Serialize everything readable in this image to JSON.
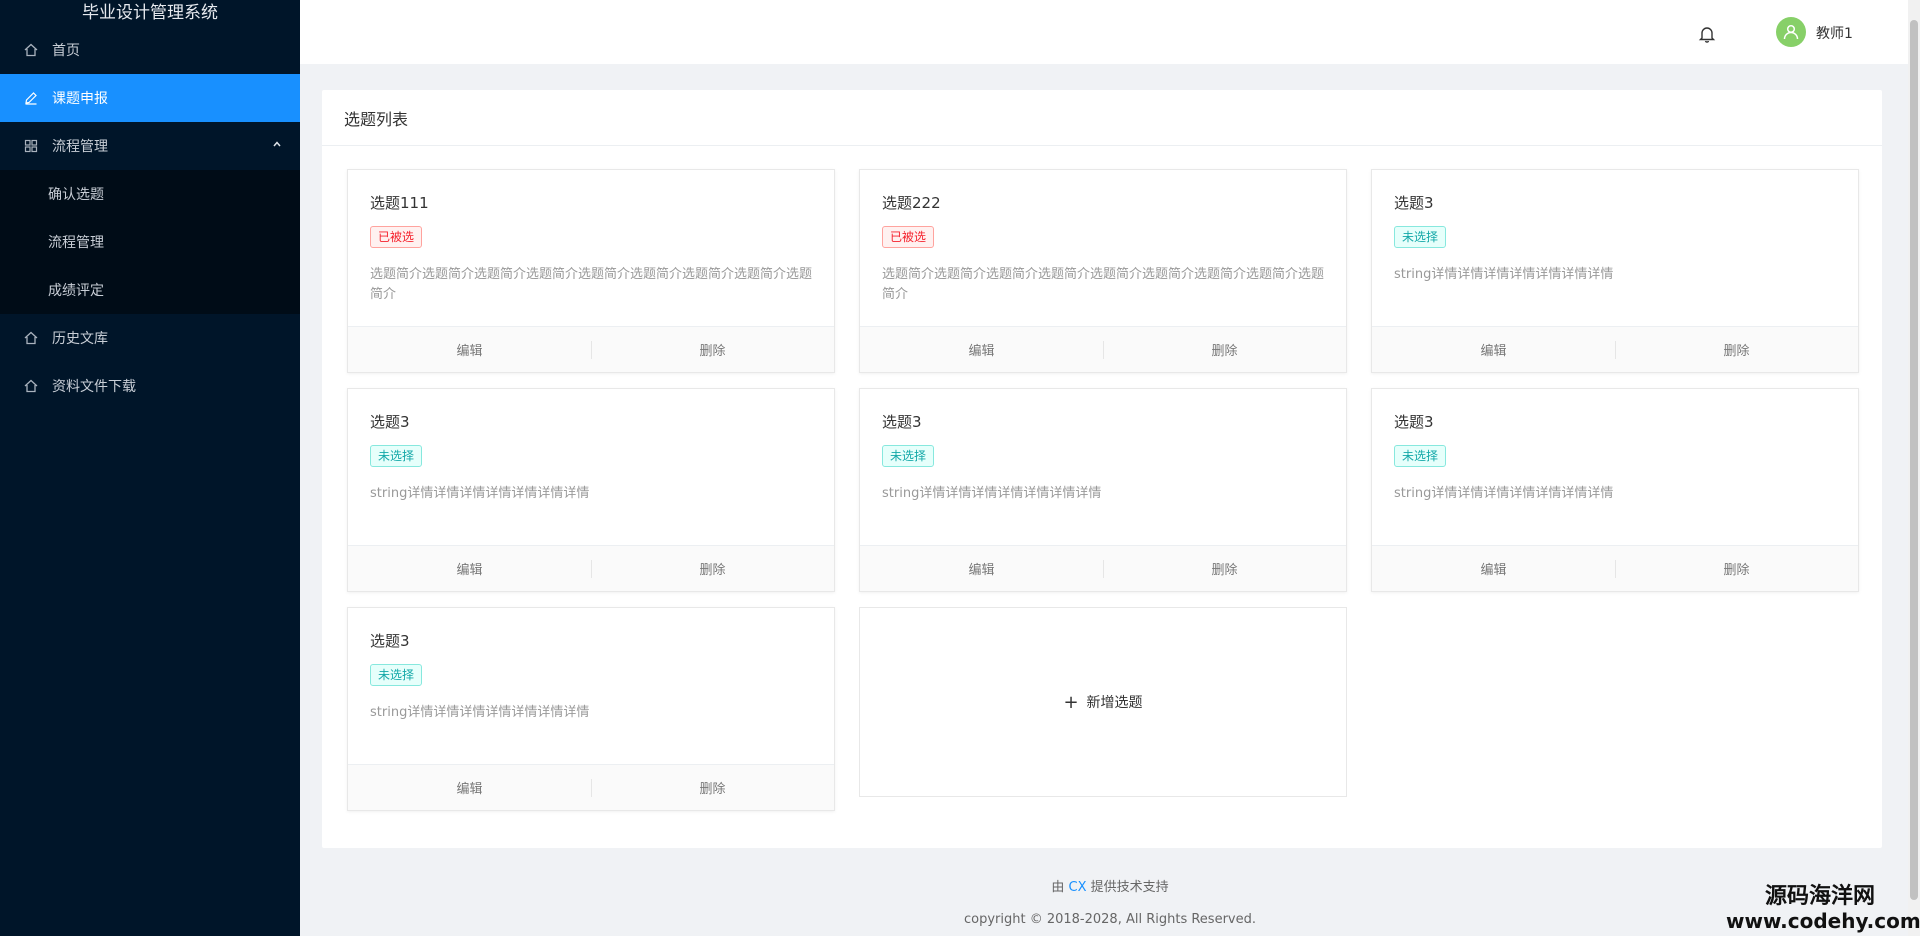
{
  "sidebar": {
    "brand": "毕业设计管理系统",
    "items": [
      {
        "label": "首页",
        "icon": "home-icon"
      },
      {
        "label": "课题申报",
        "icon": "edit-icon",
        "active": true
      },
      {
        "label": "流程管理",
        "icon": "grid-icon",
        "open": true
      },
      {
        "label": "历史文库",
        "icon": "home-icon"
      },
      {
        "label": "资料文件下载",
        "icon": "home-icon"
      }
    ],
    "submenu": [
      {
        "label": "确认选题"
      },
      {
        "label": "流程管理"
      },
      {
        "label": "成绩评定"
      }
    ]
  },
  "header": {
    "username": "教师1"
  },
  "panel": {
    "title": "选题列表",
    "cards": [
      {
        "title": "选题111",
        "tag": "已被选",
        "desc": "选题简介选题简介选题简介选题简介选题简介选题简介选题简介选题简介选题简介",
        "edit": "编辑",
        "delete": "删除"
      },
      {
        "title": "选题222",
        "tag": "已被选",
        "desc": "选题简介选题简介选题简介选题简介选题简介选题简介选题简介选题简介选题简介",
        "edit": "编辑",
        "delete": "删除"
      },
      {
        "title": "选题3",
        "tag": "未选择",
        "desc": "string详情详情详情详情详情详情详情",
        "edit": "编辑",
        "delete": "删除"
      },
      {
        "title": "选题3",
        "tag": "未选择",
        "desc": "string详情详情详情详情详情详情详情",
        "edit": "编辑",
        "delete": "删除"
      },
      {
        "title": "选题3",
        "tag": "未选择",
        "desc": "string详情详情详情详情详情详情详情",
        "edit": "编辑",
        "delete": "删除"
      },
      {
        "title": "选题3",
        "tag": "未选择",
        "desc": "string详情详情详情详情详情详情详情",
        "edit": "编辑",
        "delete": "删除"
      },
      {
        "title": "选题3",
        "tag": "未选择",
        "desc": "string详情详情详情详情详情详情详情",
        "edit": "编辑",
        "delete": "删除"
      }
    ],
    "add_label": "新增选题"
  },
  "footer": {
    "prefix": "由",
    "brand": "CX",
    "suffix": "提供技术支持",
    "copyright": "copyright © 2018-2028, All Rights Reserved."
  },
  "watermark": {
    "cn": "源码海洋网",
    "url": "www.codehy.com"
  },
  "colors": {
    "sidebar_bg": "#001529",
    "accent": "#1890ff",
    "avatar": "#87d068",
    "tag_selected": "#f5222d",
    "tag_unselected": "#13a8a8"
  }
}
